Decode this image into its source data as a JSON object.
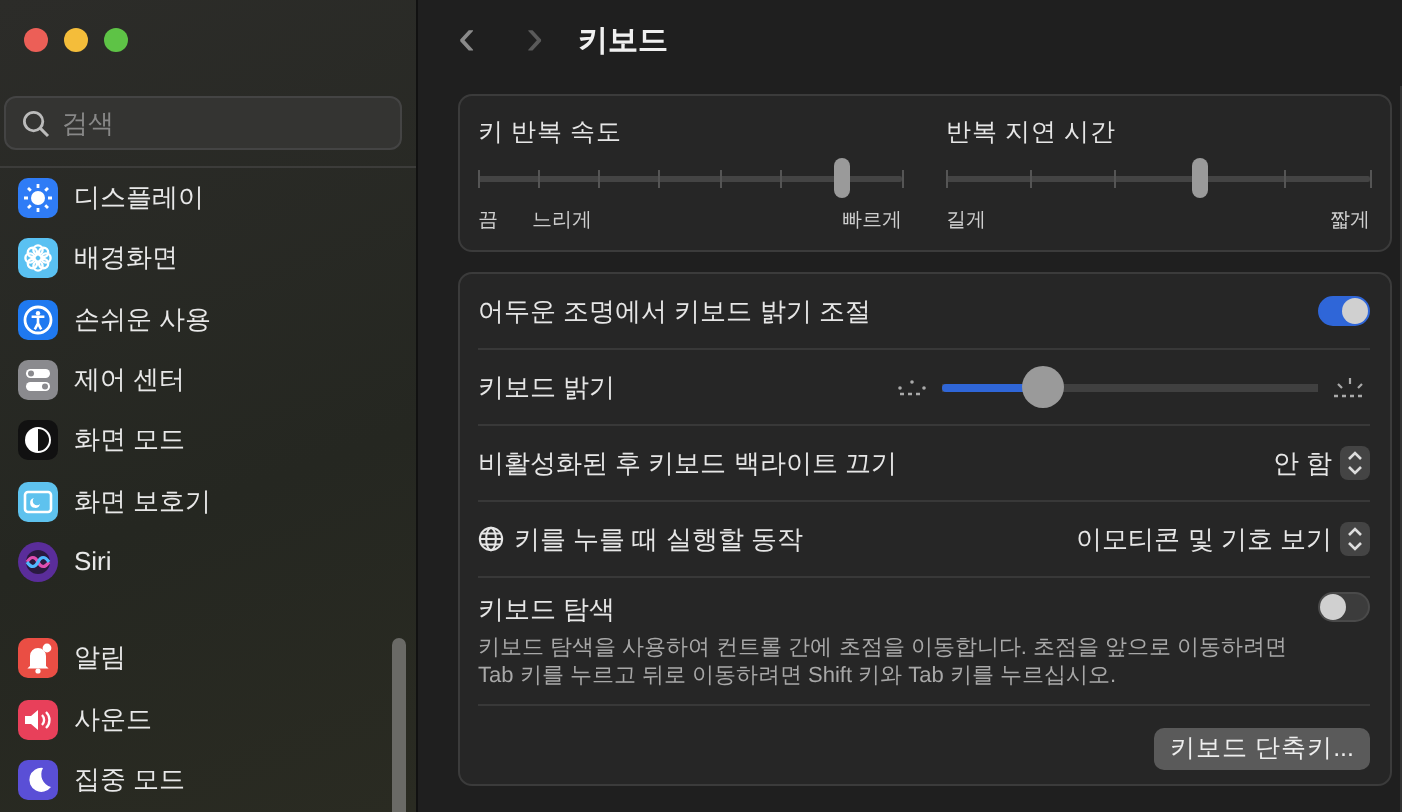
{
  "window": {
    "controls": [
      {
        "color": "#ec5f57"
      },
      {
        "color": "#f4bd3a"
      },
      {
        "color": "#5ec346"
      }
    ]
  },
  "sidebar": {
    "search": {
      "placeholder": "검색"
    },
    "groups": [
      [
        {
          "label": "디스플레이",
          "color": "#2f7cf6",
          "selected": false
        },
        {
          "label": "배경화면",
          "color": "#5ac1f2",
          "selected": false
        },
        {
          "label": "손쉬운 사용",
          "color": "#1f79f0",
          "selected": false
        },
        {
          "label": "제어 센터",
          "color": "#8a8a8e",
          "selected": false
        },
        {
          "label": "화면 모드",
          "color": "#111111",
          "selected": false
        },
        {
          "label": "화면 보호기",
          "color": "#5ec2ee",
          "selected": false
        },
        {
          "label": "Siri",
          "color": "#5a2d9a",
          "selected": false
        }
      ],
      [
        {
          "label": "알림",
          "color": "#ea4e44",
          "selected": false
        },
        {
          "label": "사운드",
          "color": "#e8405a",
          "selected": false
        },
        {
          "label": "집중 모드",
          "color": "#5a4fd6",
          "selected": false
        }
      ]
    ]
  },
  "header": {
    "back": "‹",
    "forward": "›",
    "title": "키보드"
  },
  "repeat_sliders": [
    {
      "title": "키 반복 속도",
      "level": 0.857,
      "labels": [
        "끔",
        "느리게",
        "빠르게"
      ]
    },
    {
      "title": "반복 지연 시간",
      "level": 0.6,
      "labels": [
        "길게",
        "짧게"
      ]
    }
  ],
  "settings": [
    {
      "kind": "toggle",
      "label": "어두운 조명에서 키보드 밝기 조절",
      "on": true
    },
    {
      "kind": "slider",
      "label": "키보드 밝기",
      "level": 0.27
    },
    {
      "kind": "popup",
      "label": "비활성화된 후 키보드 백라이트 끄기",
      "value": "안 함"
    },
    {
      "kind": "popup",
      "label": "키를 누를 때 실행할 동작",
      "value": "이모티콘 및 기호 보기",
      "globe": true
    },
    {
      "kind": "toggle",
      "label": "키보드 탐색",
      "on": false,
      "description": "키보드 탐색을 사용하여 컨트롤 간에 초점을 이동합니다. 초점을 앞으로 이동하려면 Tab 키를 누르고 뒤로 이동하려면 Shift 키와 Tab 키를 누르십시오."
    },
    {
      "kind": "button",
      "label": "키보드 단축키..."
    }
  ]
}
